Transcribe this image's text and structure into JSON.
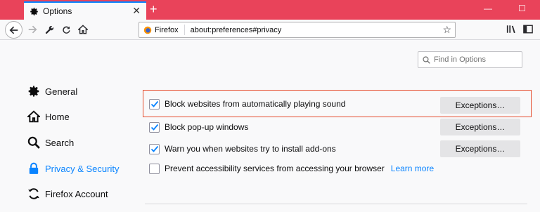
{
  "tab": {
    "title": "Options",
    "icon": "gear-icon"
  },
  "urlbar": {
    "identity": "Firefox",
    "url": "about:preferences#privacy"
  },
  "search": {
    "placeholder": "Find in Options"
  },
  "sidebar": {
    "items": [
      {
        "label": "General",
        "icon": "gear-icon",
        "selected": false
      },
      {
        "label": "Home",
        "icon": "home-icon",
        "selected": false
      },
      {
        "label": "Search",
        "icon": "search-icon",
        "selected": false
      },
      {
        "label": "Privacy & Security",
        "icon": "lock-icon",
        "selected": true
      },
      {
        "label": "Firefox Account",
        "icon": "sync-icon",
        "selected": false
      }
    ]
  },
  "permissions": {
    "rows": [
      {
        "label": "Block websites from automatically playing sound",
        "checked": true,
        "button": "Exceptions…"
      },
      {
        "label": "Block pop-up windows",
        "checked": true,
        "button": "Exceptions…"
      },
      {
        "label": "Warn you when websites try to install add-ons",
        "checked": true,
        "button": "Exceptions…"
      },
      {
        "label": "Prevent accessibility services from accessing your browser",
        "checked": false,
        "link": "Learn more"
      }
    ]
  },
  "colors": {
    "tabstrip": "#e9435a",
    "accent": "#0a84ff",
    "highlight": "#e54b2b"
  }
}
